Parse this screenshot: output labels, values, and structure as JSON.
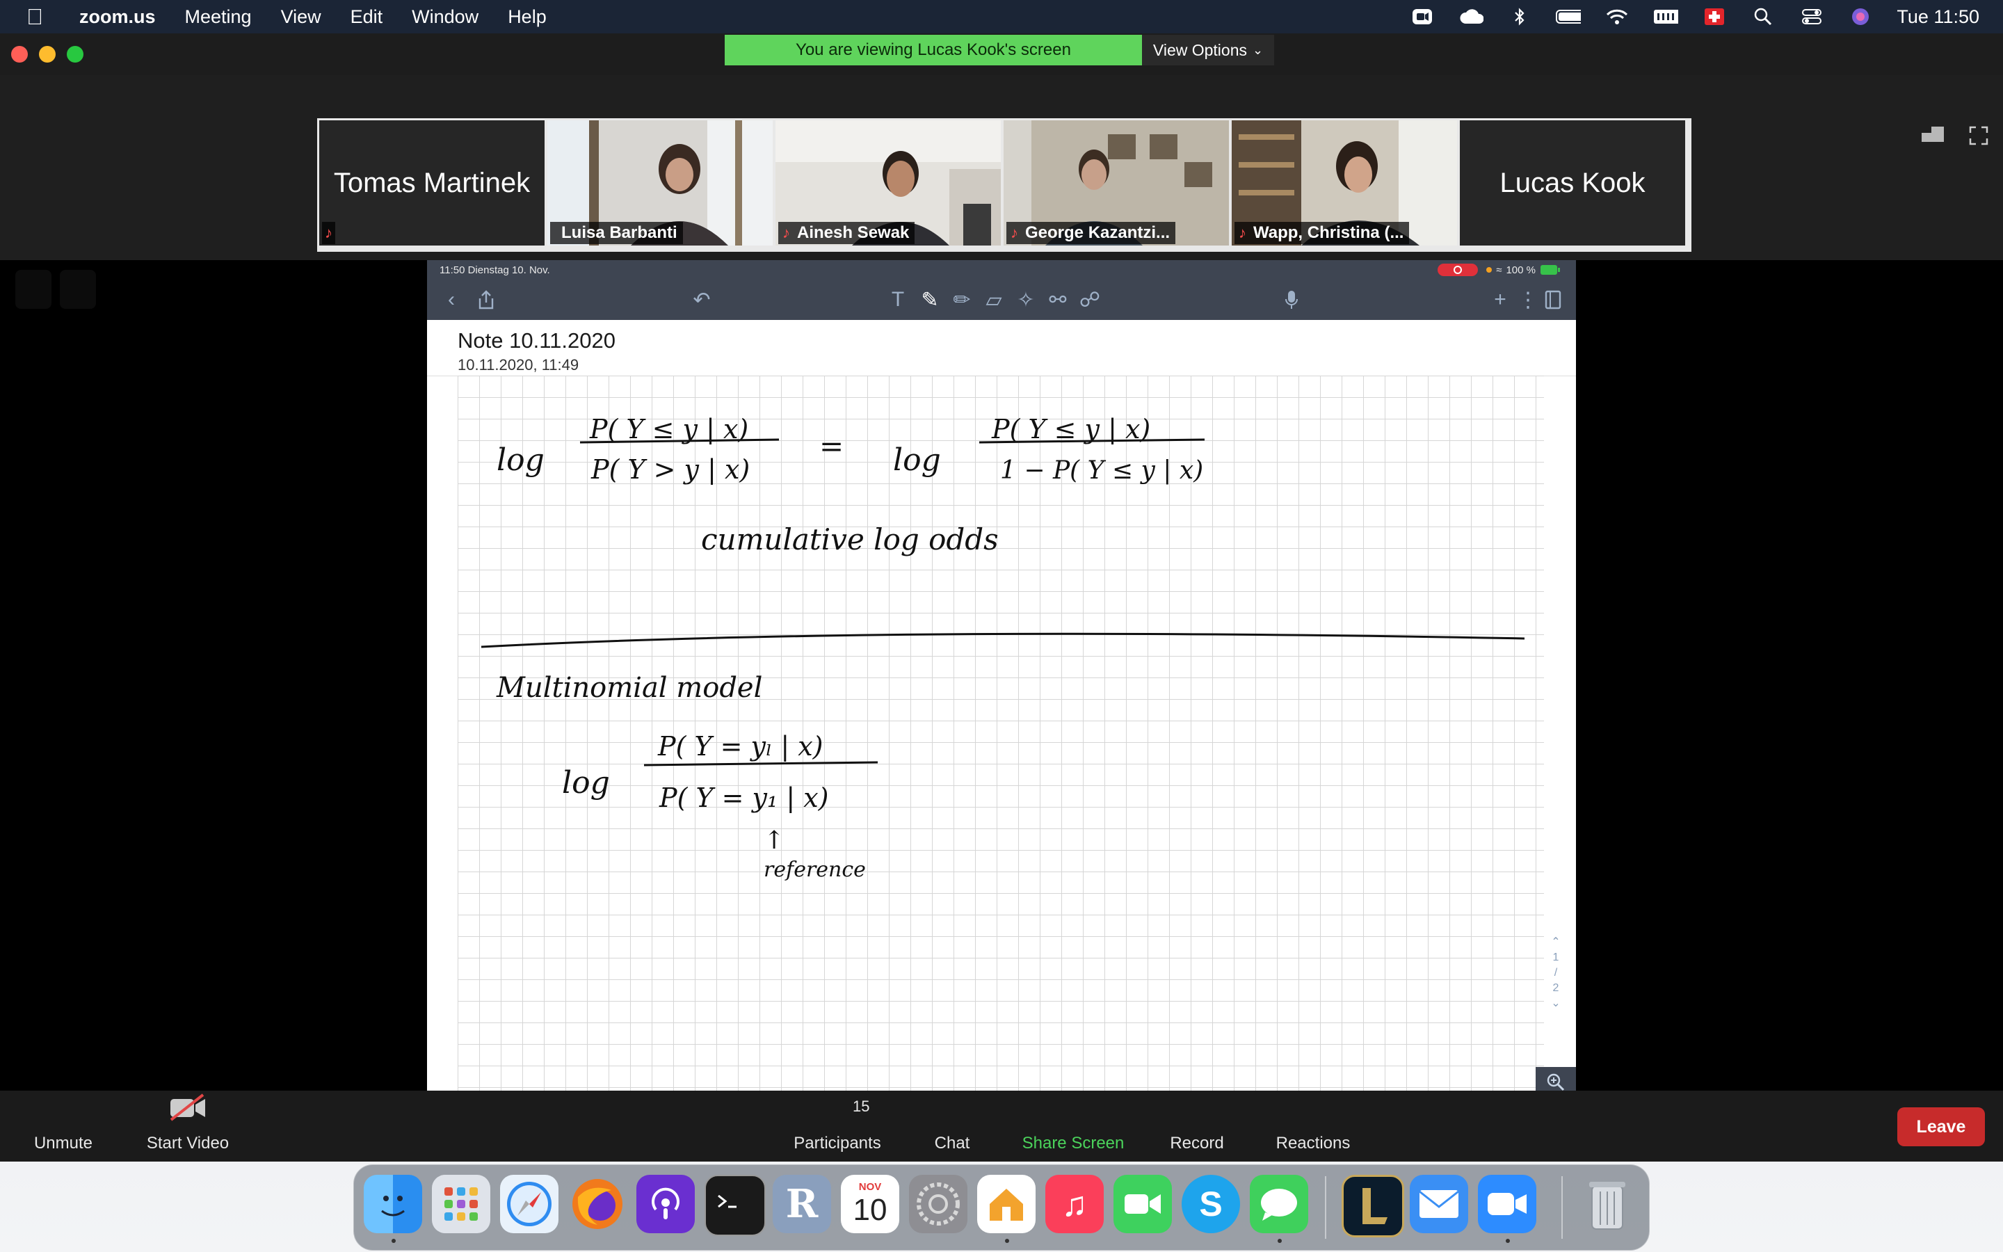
{
  "menubar": {
    "app_name": "zoom.us",
    "items": [
      "Meeting",
      "View",
      "Edit",
      "Window",
      "Help"
    ],
    "clock": "Tue 11:50"
  },
  "zoom": {
    "viewing_banner": "You are viewing Lucas Kook's screen",
    "view_options": "View Options",
    "participants": [
      {
        "name": "Tomas Martinek"
      },
      {
        "name": "Luisa Barbanti"
      },
      {
        "name": "Ainesh Sewak"
      },
      {
        "name": "George Kazantzi..."
      },
      {
        "name": "Wapp, Christina (..."
      },
      {
        "name": "Lucas Kook"
      }
    ],
    "participant_count": "15",
    "controls": {
      "unmute": "Unmute",
      "start_video": "Start Video",
      "participants": "Participants",
      "chat": "Chat",
      "share_screen": "Share Screen",
      "record": "Record",
      "reactions": "Reactions",
      "leave": "Leave"
    },
    "colors": {
      "share_active": "#4bd35b",
      "leave": "#c72b2b",
      "banner": "#5fd45c"
    }
  },
  "ipad": {
    "status_left": "11:50  Dienstag 10. Nov.",
    "status_right": "100 %",
    "note_title": "Note 10.11.2020",
    "note_date": "10.11.2020, 11:49",
    "page_indicator": [
      "1",
      "2"
    ],
    "handwriting": {
      "eq1_log_left": "log",
      "eq1_num": "P( Y ≤ y | x)",
      "eq1_den": "P( Y > y | x)",
      "eq1_equals": "=",
      "eq1_log_right": "log",
      "eq1_rnum": "P( Y ≤ y | x)",
      "eq1_rden": "1 − P( Y ≤ y | x)",
      "caption": "cumulative  log odds",
      "section": "Multinomial  model",
      "eq2_log": "log",
      "eq2_num": "P( Y = yₗ | x)",
      "eq2_den": "P( Y = y₁ | x)",
      "arrow": "↑",
      "reference": "reference"
    }
  },
  "dock": {
    "apps": [
      "finder-icon",
      "launchpad-icon",
      "safari-icon",
      "firefox-icon",
      "podcasts-icon",
      "terminal-icon",
      "r-icon",
      "calendar-icon",
      "system-preferences-icon",
      "home-icon",
      "music-icon",
      "facetime-icon",
      "skype-icon",
      "messages-icon",
      "league-icon",
      "mail-icon",
      "zoom-icon",
      "trash-icon"
    ],
    "calendar_month": "NOV",
    "calendar_day": "10",
    "r_letter": "R",
    "skype_letter": "S"
  }
}
